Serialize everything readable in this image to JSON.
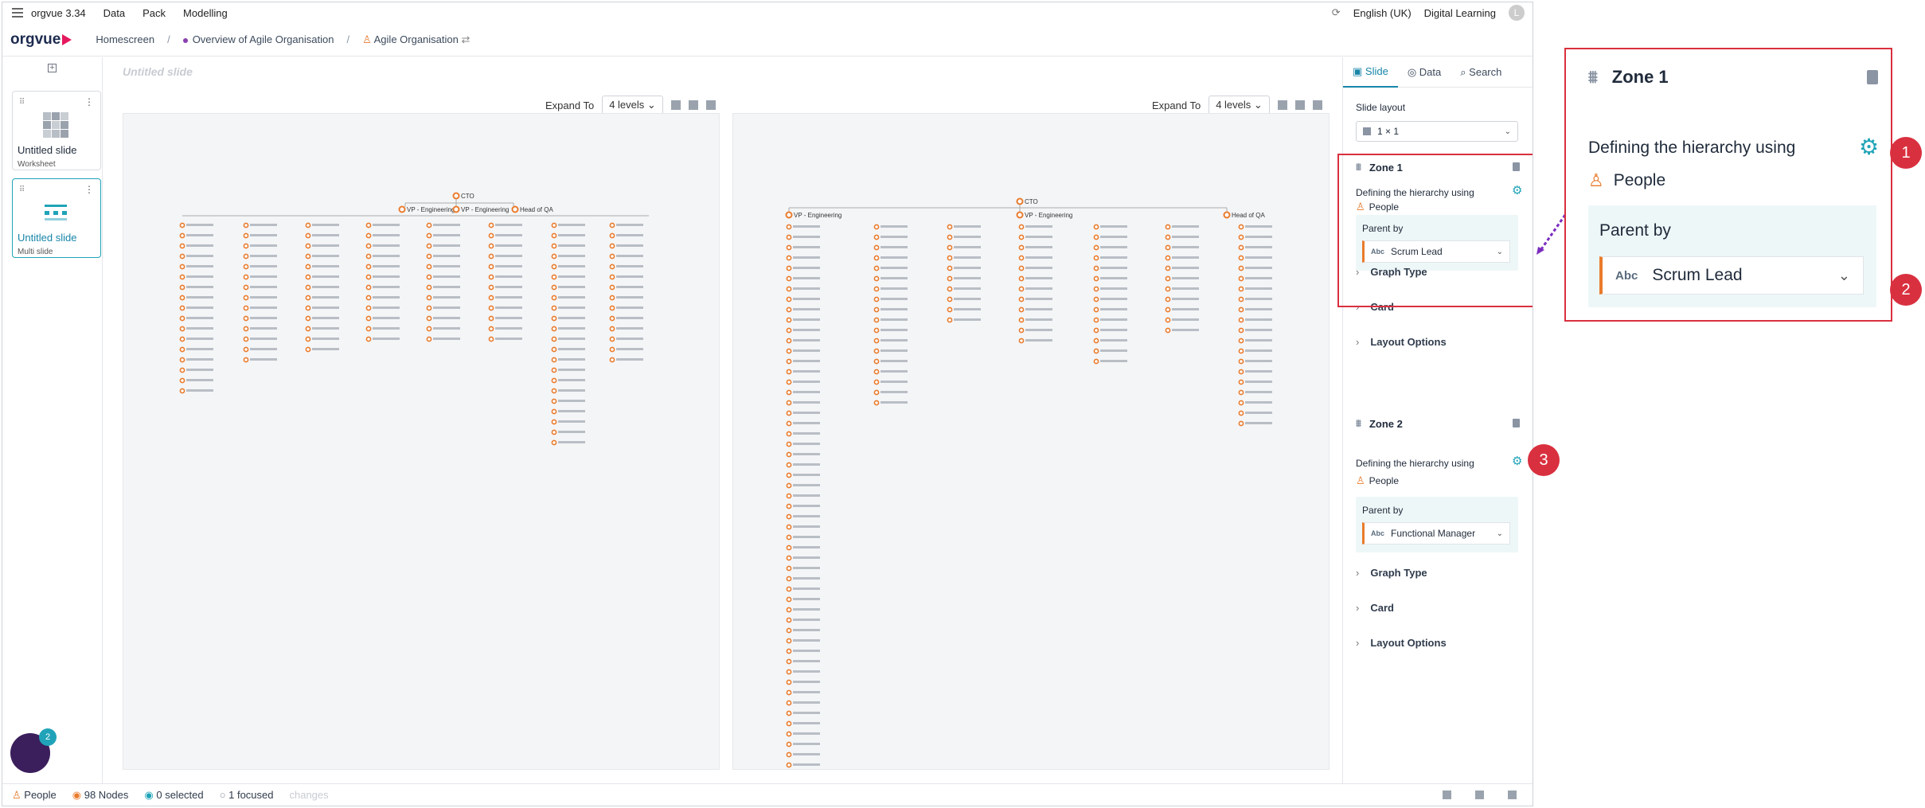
{
  "app": {
    "name": "orgvue 3.34",
    "menu": [
      "Data",
      "Pack",
      "Modelling"
    ],
    "language": "English (UK)",
    "workspace": "Digital Learning",
    "user_initial": "L"
  },
  "nav": {
    "logo": "orgvue",
    "crumbs": [
      "Homescreen",
      "Overview of Agile Organisation",
      "Agile Organisation"
    ]
  },
  "slides": [
    {
      "title": "Untitled slide",
      "subtitle": "Worksheet"
    },
    {
      "title": "Untitled slide",
      "subtitle": "Multi slide"
    }
  ],
  "stage": {
    "title": "Untitled slide",
    "expand_label": "Expand To",
    "expand_value": "4 levels"
  },
  "panel": {
    "tabs": [
      "Slide",
      "Data",
      "Search"
    ],
    "slide_layout_label": "Slide layout",
    "slide_layout_value": "1 × 1",
    "zone1": {
      "title": "Zone 1",
      "define": "Defining the hierarchy using",
      "entity": "People",
      "parent_label": "Parent by",
      "parent_abc": "Abc",
      "parent_value": "Scrum Lead"
    },
    "zone2": {
      "title": "Zone 2",
      "define": "Defining the hierarchy using",
      "entity": "People",
      "parent_label": "Parent by",
      "parent_abc": "Abc",
      "parent_value": "Functional Manager"
    },
    "sections": [
      "Graph Type",
      "Card",
      "Layout Options"
    ]
  },
  "footer": {
    "entity": "People",
    "nodes": "98 Nodes",
    "selected": "0 selected",
    "focused": "1 focused",
    "changes": "changes"
  },
  "callouts": [
    "1",
    "2",
    "3"
  ],
  "chat_badge": "2",
  "chart1": {
    "root": "CTO",
    "level1": [
      "VP - Engineering",
      "VP - Engineering",
      "Head of QA"
    ]
  },
  "chart2": {
    "root": "CTO",
    "level1": [
      "VP - Engineering",
      "VP - Engineering",
      "Head of QA"
    ]
  }
}
